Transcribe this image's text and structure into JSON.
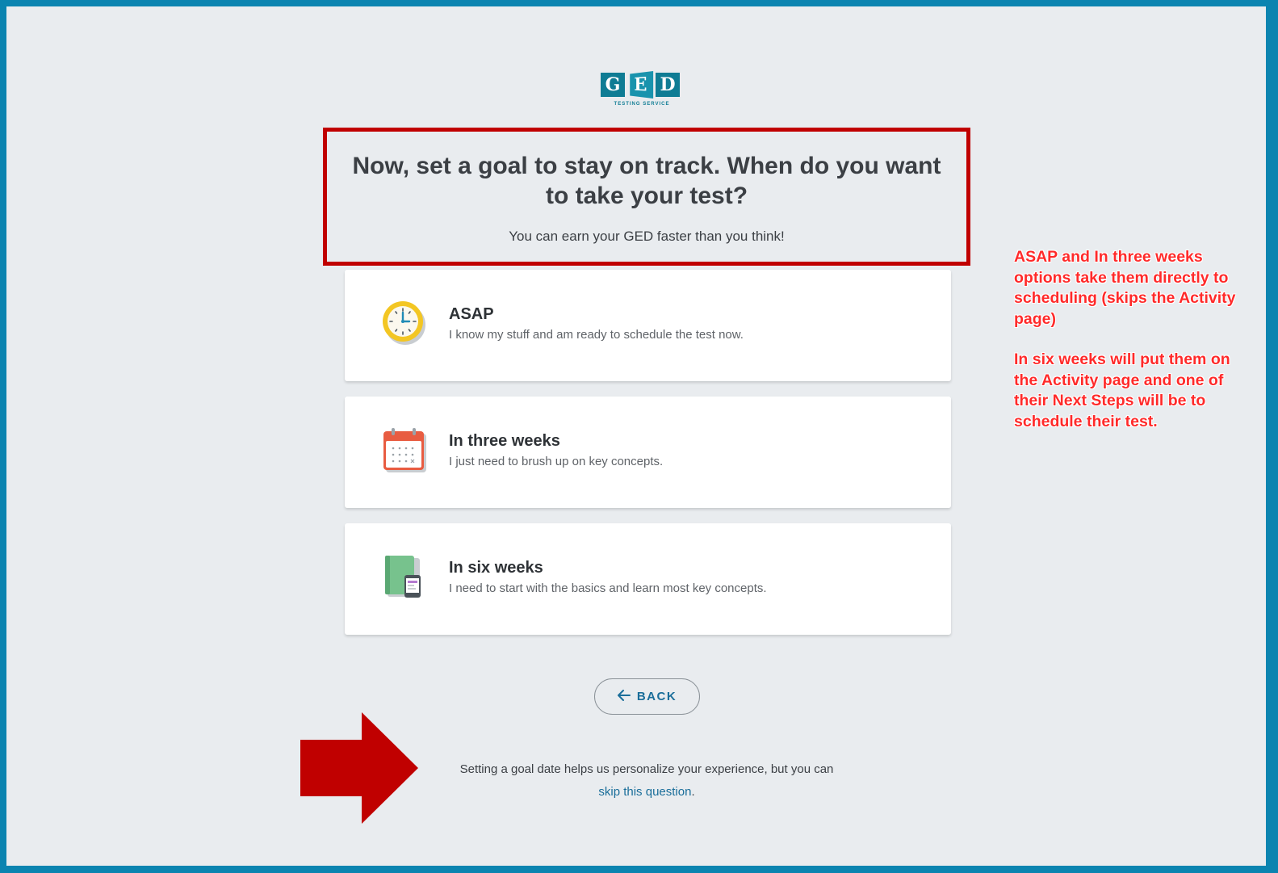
{
  "logo": {
    "letters": [
      "G",
      "E",
      "D"
    ],
    "subtitle": "TESTING SERVICE"
  },
  "header": {
    "title": "Now, set a goal to stay on track. When do you want to take your test?",
    "subtitle": "You can earn your GED faster than you think!"
  },
  "options": [
    {
      "label": "ASAP",
      "description": "I know my stuff and am ready to schedule the test now.",
      "icon": "clock-icon"
    },
    {
      "label": "In three weeks",
      "description": "I just need to brush up on key concepts.",
      "icon": "calendar-icon"
    },
    {
      "label": "In six weeks",
      "description": "I need to start with the basics and learn most key concepts.",
      "icon": "book-icon"
    }
  ],
  "back_button": {
    "label": "BACK",
    "icon": "arrow-left-icon"
  },
  "footer": {
    "text": "Setting a goal date helps us personalize your experience, but you can",
    "link": "skip this question",
    "period": "."
  },
  "annotations": {
    "note1": "ASAP and In three weeks options take them directly to scheduling (skips the Activity page)",
    "note2": "In six weeks will put them on the Activity page and one of their Next Steps will be to schedule their test."
  },
  "colors": {
    "frame": "#0b84b0",
    "background": "#e9ecef",
    "highlight_border": "#c00000",
    "annotation_text": "#ff2a2a",
    "link": "#1a6e9a",
    "arrow": "#c00000"
  }
}
